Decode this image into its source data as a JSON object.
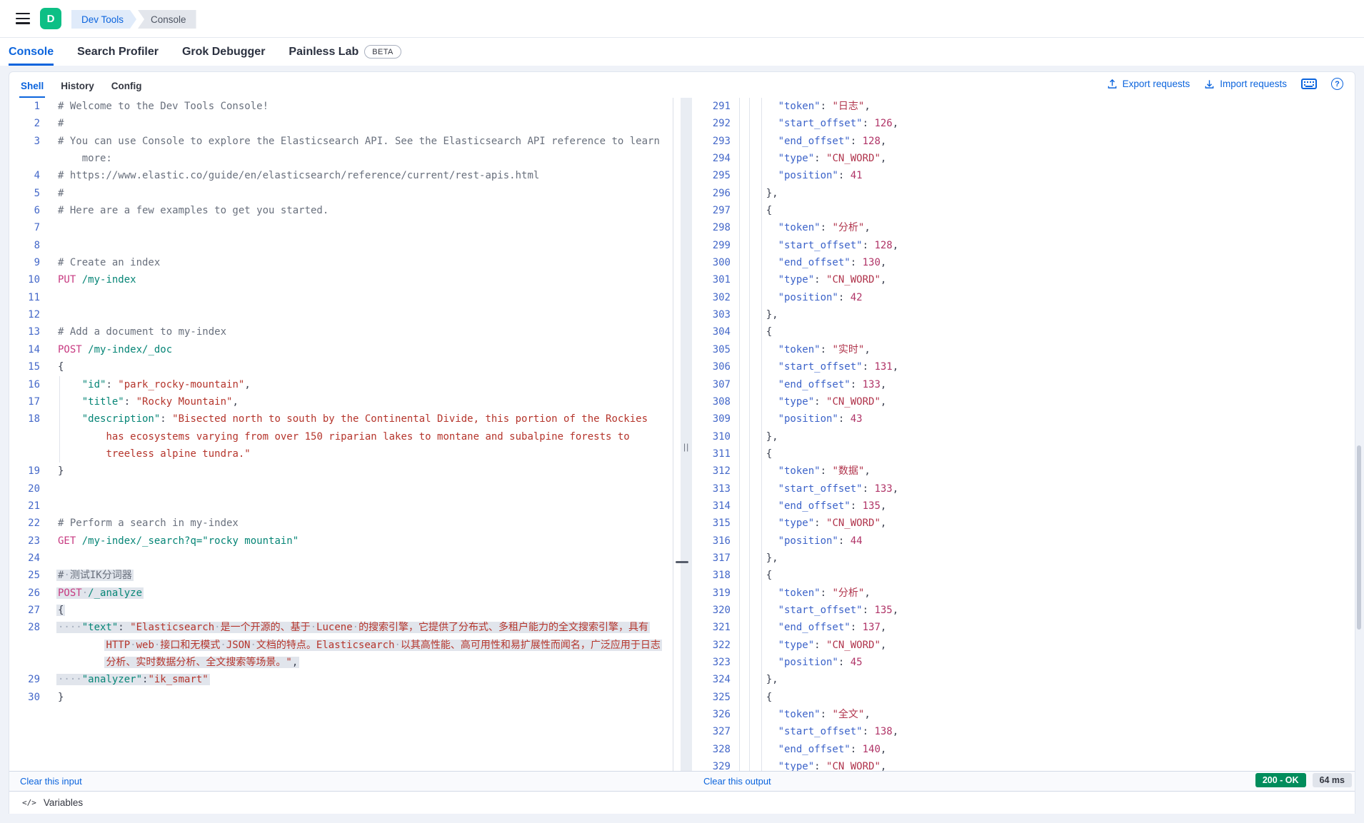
{
  "chrome": {
    "logo_letter": "D",
    "breadcrumbs": [
      {
        "label": "Dev Tools"
      },
      {
        "label": "Console"
      }
    ]
  },
  "nav_tabs": [
    {
      "label": "Console",
      "active": true
    },
    {
      "label": "Search Profiler"
    },
    {
      "label": "Grok Debugger"
    },
    {
      "label": "Painless Lab",
      "beta": "BETA"
    }
  ],
  "toolbar": {
    "tabs": [
      {
        "label": "Shell",
        "active": true
      },
      {
        "label": "History"
      },
      {
        "label": "Config"
      }
    ],
    "export_label": "Export requests",
    "import_label": "Import requests",
    "keyboard_icon": "keyboard-shortcuts",
    "help_icon": "help",
    "help_glyph": "?"
  },
  "splitter_grip": "||",
  "footer": {
    "clear_input": "Clear this input",
    "clear_output": "Clear this output",
    "status_badge": "200 - OK",
    "time_badge": "64 ms",
    "variables_label": "Variables",
    "variables_icon": "</>"
  },
  "colors": {
    "primary_blue": "#0B64DD",
    "logo_green": "#0DBF85",
    "badge_green": "#018D5C",
    "sel_bg": "#E1E5EC",
    "method_pink": "#C73A81",
    "teal": "#068576",
    "string_red": "#B5352C",
    "output_key_blue": "#3C63C9",
    "output_string": "#B0344C",
    "output_number": "#B03467",
    "gutter_blue": "#4468C9",
    "comment_gray": "#69707D"
  },
  "editor": {
    "lines": [
      {
        "n": "1",
        "t": [
          [
            "c",
            "# Welcome to the Dev Tools Console!"
          ]
        ]
      },
      {
        "n": "2",
        "t": [
          [
            "c",
            "#"
          ]
        ]
      },
      {
        "n": "3",
        "t": [
          [
            "c",
            "# You can use Console to explore the Elasticsearch API. See the Elasticsearch API reference to learn"
          ]
        ]
      },
      {
        "n": "",
        "i": 4,
        "t": [
          [
            "c",
            "more:"
          ]
        ]
      },
      {
        "n": "4",
        "t": [
          [
            "c",
            "# https://www.elastic.co/guide/en/elasticsearch/reference/current/rest-apis.html"
          ]
        ]
      },
      {
        "n": "5",
        "t": [
          [
            "c",
            "#"
          ]
        ]
      },
      {
        "n": "6",
        "t": [
          [
            "c",
            "# Here are a few examples to get you started."
          ]
        ]
      },
      {
        "n": "7",
        "t": []
      },
      {
        "n": "8",
        "t": []
      },
      {
        "n": "9",
        "t": [
          [
            "c",
            "# Create an index"
          ]
        ]
      },
      {
        "n": "10",
        "t": [
          [
            "m",
            "PUT"
          ],
          [
            "p",
            " "
          ],
          [
            "u",
            "/my-index"
          ]
        ]
      },
      {
        "n": "11",
        "t": []
      },
      {
        "n": "12",
        "t": []
      },
      {
        "n": "13",
        "t": [
          [
            "c",
            "# Add a document to my-index"
          ]
        ]
      },
      {
        "n": "14",
        "t": [
          [
            "m",
            "POST"
          ],
          [
            "p",
            " "
          ],
          [
            "u",
            "/my-index/_doc"
          ]
        ]
      },
      {
        "n": "15",
        "t": [
          [
            "p",
            "{"
          ]
        ]
      },
      {
        "n": "16",
        "i": 4,
        "g": [
          2
        ],
        "t": [
          [
            "k",
            "\"id\""
          ],
          [
            "p",
            ": "
          ],
          [
            "s",
            "\"park_rocky-mountain\""
          ],
          [
            "p",
            ","
          ]
        ]
      },
      {
        "n": "17",
        "i": 4,
        "g": [
          2
        ],
        "t": [
          [
            "k",
            "\"title\""
          ],
          [
            "p",
            ": "
          ],
          [
            "s",
            "\"Rocky Mountain\""
          ],
          [
            "p",
            ","
          ]
        ]
      },
      {
        "n": "18",
        "i": 4,
        "g": [
          2
        ],
        "t": [
          [
            "k",
            "\"description\""
          ],
          [
            "p",
            ": "
          ],
          [
            "s",
            "\"Bisected north to south by the Continental Divide, this portion of the Rockies"
          ]
        ]
      },
      {
        "n": "",
        "i": 8,
        "g": [
          2
        ],
        "t": [
          [
            "s",
            "has ecosystems varying from over 150 riparian lakes to montane and subalpine forests to"
          ]
        ]
      },
      {
        "n": "",
        "i": 8,
        "g": [
          2
        ],
        "t": [
          [
            "s",
            "treeless alpine tundra.\""
          ]
        ]
      },
      {
        "n": "19",
        "t": [
          [
            "p",
            "}"
          ]
        ]
      },
      {
        "n": "20",
        "t": []
      },
      {
        "n": "21",
        "t": []
      },
      {
        "n": "22",
        "t": [
          [
            "c",
            "# Perform a search in my-index"
          ]
        ]
      },
      {
        "n": "23",
        "t": [
          [
            "m",
            "GET"
          ],
          [
            "p",
            " "
          ],
          [
            "u",
            "/my-index/_search?q=\"rocky mountain\""
          ]
        ]
      },
      {
        "n": "24",
        "t": []
      },
      {
        "n": "25",
        "sel": true,
        "t": [
          [
            "c",
            "#"
          ],
          [
            "d",
            "·"
          ],
          [
            "c",
            "测试IK分词器"
          ]
        ]
      },
      {
        "n": "26",
        "sel": true,
        "t": [
          [
            "m",
            "POST"
          ],
          [
            "d",
            "·"
          ],
          [
            "u",
            "/_analyze"
          ]
        ]
      },
      {
        "n": "27",
        "sel": true,
        "t": [
          [
            "p",
            "{"
          ]
        ]
      },
      {
        "n": "28",
        "sel": true,
        "t": [
          [
            "d",
            "····"
          ],
          [
            "k",
            "\"text\""
          ],
          [
            "p",
            ": "
          ],
          [
            "s",
            "\"Elasticsearch"
          ],
          [
            "d",
            "·"
          ],
          [
            "s",
            "是一个开源的、基于"
          ],
          [
            "d",
            "·"
          ],
          [
            "s",
            "Lucene"
          ],
          [
            "d",
            "·"
          ],
          [
            "s",
            "的搜索引擎，它提供了分布式、多租户能力的全文搜索引擎，具有"
          ]
        ]
      },
      {
        "n": "",
        "i": 8,
        "sel": true,
        "t": [
          [
            "s",
            "HTTP"
          ],
          [
            "d",
            "·"
          ],
          [
            "s",
            "web"
          ],
          [
            "d",
            "·"
          ],
          [
            "s",
            "接口和无模式"
          ],
          [
            "d",
            "·"
          ],
          [
            "s",
            "JSON"
          ],
          [
            "d",
            "·"
          ],
          [
            "s",
            "文档的特点。Elasticsearch"
          ],
          [
            "d",
            "·"
          ],
          [
            "s",
            "以其高性能、高可用性和易扩展性而闻名，广泛应用于日志"
          ]
        ]
      },
      {
        "n": "",
        "i": 8,
        "sel": true,
        "t": [
          [
            "s",
            "分析、实时数据分析、全文搜索等场景。\""
          ],
          [
            "p",
            ","
          ]
        ]
      },
      {
        "n": "29",
        "sel": true,
        "t": [
          [
            "d",
            "····"
          ],
          [
            "k",
            "\"analyzer\""
          ],
          [
            "p",
            ":"
          ],
          [
            "s",
            "\"ik_smart\""
          ]
        ]
      },
      {
        "n": "30",
        "t": [
          [
            "p",
            "}"
          ]
        ]
      }
    ]
  },
  "output": {
    "lines": [
      {
        "n": "291",
        "i": 6,
        "t": [
          [
            "k2",
            "\"token\""
          ],
          [
            "p",
            ": "
          ],
          [
            "s2",
            "\"日志\""
          ],
          [
            "p",
            ","
          ]
        ]
      },
      {
        "n": "292",
        "i": 6,
        "t": [
          [
            "k2",
            "\"start_offset\""
          ],
          [
            "p",
            ": "
          ],
          [
            "n2",
            "126"
          ],
          [
            "p",
            ","
          ]
        ]
      },
      {
        "n": "293",
        "i": 6,
        "t": [
          [
            "k2",
            "\"end_offset\""
          ],
          [
            "p",
            ": "
          ],
          [
            "n2",
            "128"
          ],
          [
            "p",
            ","
          ]
        ]
      },
      {
        "n": "294",
        "i": 6,
        "t": [
          [
            "k2",
            "\"type\""
          ],
          [
            "p",
            ": "
          ],
          [
            "s2",
            "\"CN_WORD\""
          ],
          [
            "p",
            ","
          ]
        ]
      },
      {
        "n": "295",
        "i": 6,
        "t": [
          [
            "k2",
            "\"position\""
          ],
          [
            "p",
            ": "
          ],
          [
            "n2",
            "41"
          ]
        ]
      },
      {
        "n": "296",
        "i": 4,
        "t": [
          [
            "p",
            "},"
          ]
        ]
      },
      {
        "n": "297",
        "i": 4,
        "t": [
          [
            "p",
            "{"
          ]
        ]
      },
      {
        "n": "298",
        "i": 6,
        "t": [
          [
            "k2",
            "\"token\""
          ],
          [
            "p",
            ": "
          ],
          [
            "s2",
            "\"分析\""
          ],
          [
            "p",
            ","
          ]
        ]
      },
      {
        "n": "299",
        "i": 6,
        "t": [
          [
            "k2",
            "\"start_offset\""
          ],
          [
            "p",
            ": "
          ],
          [
            "n2",
            "128"
          ],
          [
            "p",
            ","
          ]
        ]
      },
      {
        "n": "300",
        "i": 6,
        "t": [
          [
            "k2",
            "\"end_offset\""
          ],
          [
            "p",
            ": "
          ],
          [
            "n2",
            "130"
          ],
          [
            "p",
            ","
          ]
        ]
      },
      {
        "n": "301",
        "i": 6,
        "t": [
          [
            "k2",
            "\"type\""
          ],
          [
            "p",
            ": "
          ],
          [
            "s2",
            "\"CN_WORD\""
          ],
          [
            "p",
            ","
          ]
        ]
      },
      {
        "n": "302",
        "i": 6,
        "t": [
          [
            "k2",
            "\"position\""
          ],
          [
            "p",
            ": "
          ],
          [
            "n2",
            "42"
          ]
        ]
      },
      {
        "n": "303",
        "i": 4,
        "t": [
          [
            "p",
            "},"
          ]
        ]
      },
      {
        "n": "304",
        "i": 4,
        "t": [
          [
            "p",
            "{"
          ]
        ]
      },
      {
        "n": "305",
        "i": 6,
        "t": [
          [
            "k2",
            "\"token\""
          ],
          [
            "p",
            ": "
          ],
          [
            "s2",
            "\"实时\""
          ],
          [
            "p",
            ","
          ]
        ]
      },
      {
        "n": "306",
        "i": 6,
        "t": [
          [
            "k2",
            "\"start_offset\""
          ],
          [
            "p",
            ": "
          ],
          [
            "n2",
            "131"
          ],
          [
            "p",
            ","
          ]
        ]
      },
      {
        "n": "307",
        "i": 6,
        "t": [
          [
            "k2",
            "\"end_offset\""
          ],
          [
            "p",
            ": "
          ],
          [
            "n2",
            "133"
          ],
          [
            "p",
            ","
          ]
        ]
      },
      {
        "n": "308",
        "i": 6,
        "t": [
          [
            "k2",
            "\"type\""
          ],
          [
            "p",
            ": "
          ],
          [
            "s2",
            "\"CN_WORD\""
          ],
          [
            "p",
            ","
          ]
        ]
      },
      {
        "n": "309",
        "i": 6,
        "t": [
          [
            "k2",
            "\"position\""
          ],
          [
            "p",
            ": "
          ],
          [
            "n2",
            "43"
          ]
        ]
      },
      {
        "n": "310",
        "i": 4,
        "t": [
          [
            "p",
            "},"
          ]
        ]
      },
      {
        "n": "311",
        "i": 4,
        "t": [
          [
            "p",
            "{"
          ]
        ]
      },
      {
        "n": "312",
        "i": 6,
        "t": [
          [
            "k2",
            "\"token\""
          ],
          [
            "p",
            ": "
          ],
          [
            "s2",
            "\"数据\""
          ],
          [
            "p",
            ","
          ]
        ]
      },
      {
        "n": "313",
        "i": 6,
        "t": [
          [
            "k2",
            "\"start_offset\""
          ],
          [
            "p",
            ": "
          ],
          [
            "n2",
            "133"
          ],
          [
            "p",
            ","
          ]
        ]
      },
      {
        "n": "314",
        "i": 6,
        "t": [
          [
            "k2",
            "\"end_offset\""
          ],
          [
            "p",
            ": "
          ],
          [
            "n2",
            "135"
          ],
          [
            "p",
            ","
          ]
        ]
      },
      {
        "n": "315",
        "i": 6,
        "t": [
          [
            "k2",
            "\"type\""
          ],
          [
            "p",
            ": "
          ],
          [
            "s2",
            "\"CN_WORD\""
          ],
          [
            "p",
            ","
          ]
        ]
      },
      {
        "n": "316",
        "i": 6,
        "t": [
          [
            "k2",
            "\"position\""
          ],
          [
            "p",
            ": "
          ],
          [
            "n2",
            "44"
          ]
        ]
      },
      {
        "n": "317",
        "i": 4,
        "t": [
          [
            "p",
            "},"
          ]
        ]
      },
      {
        "n": "318",
        "i": 4,
        "t": [
          [
            "p",
            "{"
          ]
        ]
      },
      {
        "n": "319",
        "i": 6,
        "t": [
          [
            "k2",
            "\"token\""
          ],
          [
            "p",
            ": "
          ],
          [
            "s2",
            "\"分析\""
          ],
          [
            "p",
            ","
          ]
        ]
      },
      {
        "n": "320",
        "i": 6,
        "t": [
          [
            "k2",
            "\"start_offset\""
          ],
          [
            "p",
            ": "
          ],
          [
            "n2",
            "135"
          ],
          [
            "p",
            ","
          ]
        ]
      },
      {
        "n": "321",
        "i": 6,
        "t": [
          [
            "k2",
            "\"end_offset\""
          ],
          [
            "p",
            ": "
          ],
          [
            "n2",
            "137"
          ],
          [
            "p",
            ","
          ]
        ]
      },
      {
        "n": "322",
        "i": 6,
        "t": [
          [
            "k2",
            "\"type\""
          ],
          [
            "p",
            ": "
          ],
          [
            "s2",
            "\"CN_WORD\""
          ],
          [
            "p",
            ","
          ]
        ]
      },
      {
        "n": "323",
        "i": 6,
        "t": [
          [
            "k2",
            "\"position\""
          ],
          [
            "p",
            ": "
          ],
          [
            "n2",
            "45"
          ]
        ]
      },
      {
        "n": "324",
        "i": 4,
        "t": [
          [
            "p",
            "},"
          ]
        ]
      },
      {
        "n": "325",
        "i": 4,
        "t": [
          [
            "p",
            "{"
          ]
        ]
      },
      {
        "n": "326",
        "i": 6,
        "t": [
          [
            "k2",
            "\"token\""
          ],
          [
            "p",
            ": "
          ],
          [
            "s2",
            "\"全文\""
          ],
          [
            "p",
            ","
          ]
        ]
      },
      {
        "n": "327",
        "i": 6,
        "t": [
          [
            "k2",
            "\"start_offset\""
          ],
          [
            "p",
            ": "
          ],
          [
            "n2",
            "138"
          ],
          [
            "p",
            ","
          ]
        ]
      },
      {
        "n": "328",
        "i": 6,
        "t": [
          [
            "k2",
            "\"end_offset\""
          ],
          [
            "p",
            ": "
          ],
          [
            "n2",
            "140"
          ],
          [
            "p",
            ","
          ]
        ]
      },
      {
        "n": "329",
        "i": 6,
        "t": [
          [
            "k2",
            "\"type\""
          ],
          [
            "p",
            ": "
          ],
          [
            "s2",
            "\"CN_WORD\""
          ],
          [
            "p",
            ","
          ]
        ]
      }
    ]
  }
}
